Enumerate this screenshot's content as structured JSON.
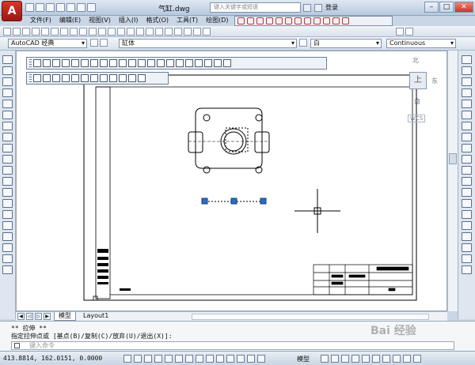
{
  "window": {
    "app_logo": "A",
    "title": "气缸.dwg",
    "search_placeholder": "键入关键字或短语",
    "login": "登录",
    "minimize": "–",
    "maximize": "□",
    "close": "✕"
  },
  "menu": [
    "文件(F)",
    "编辑(E)",
    "视图(V)",
    "插入(I)",
    "格式(O)",
    "工具(T)",
    "绘图(D)"
  ],
  "toolbars": {
    "workspace": "AutoCAD 经典",
    "layer": "缸体",
    "color": "白",
    "linetype": "Continuous"
  },
  "viewcube": {
    "north": "北",
    "east": "东",
    "south": "南",
    "face": "上",
    "wcs": "WCS"
  },
  "tabs": {
    "model": "模型",
    "layout": "Layout1"
  },
  "command": {
    "line1": "** 拉伸 **",
    "line2": "指定拉伸点或 [基点(B)/复制(C)/放弃(U)/退出(X)]:",
    "input_placeholder": "键入命令"
  },
  "status": {
    "coords": "413.8814, 162.0151, 0.0000",
    "model": "模型"
  },
  "watermark": "Bai 经验"
}
